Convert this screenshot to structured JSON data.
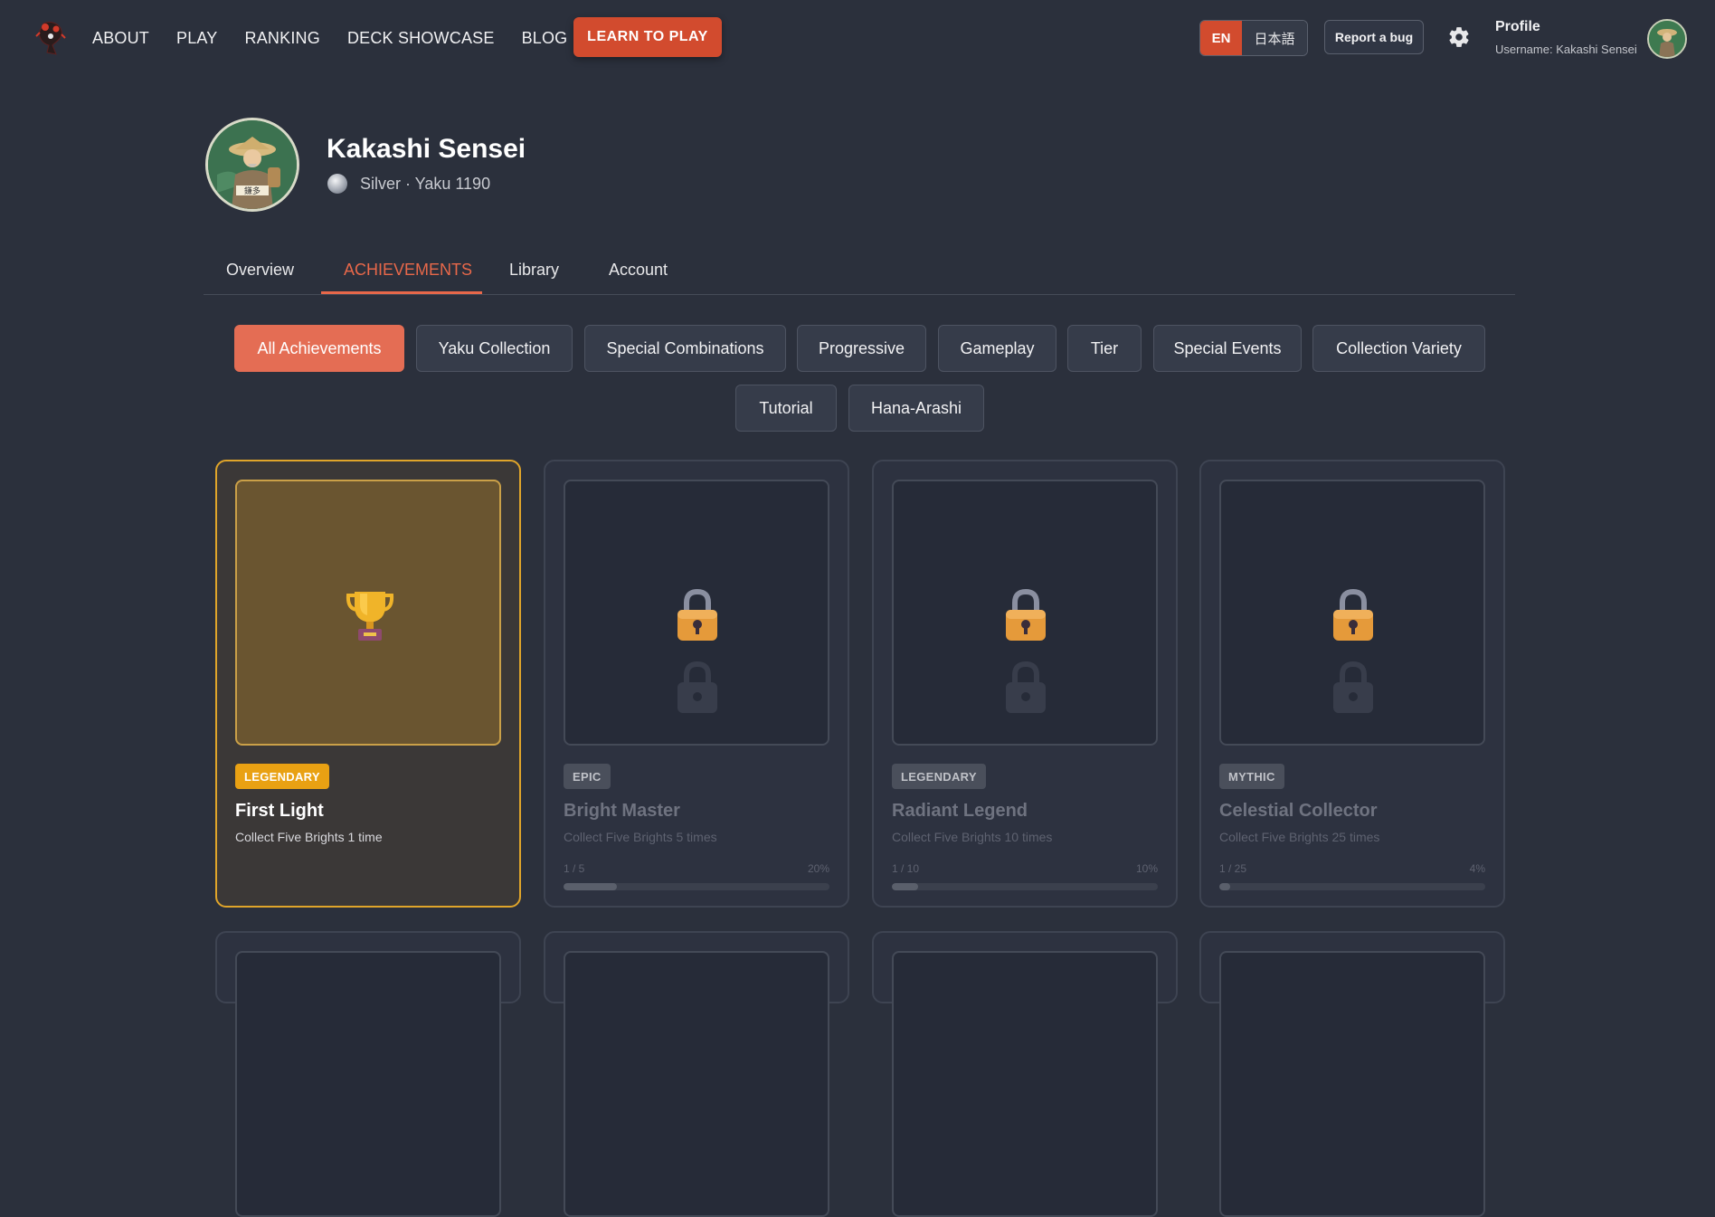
{
  "nav": {
    "items": [
      "ABOUT",
      "PLAY",
      "RANKING",
      "DECK SHOWCASE",
      "BLOG"
    ],
    "learn_label": "LEARN TO PLAY",
    "lang_en": "EN",
    "lang_ja": "日本語",
    "bug_label": "Report a bug",
    "profile_label": "Profile",
    "username_line": "Username: Kakashi Sensei"
  },
  "profile": {
    "name": "Kakashi Sensei",
    "rank_line": "Silver · Yaku 1190",
    "avatar_caption": "鎌多"
  },
  "tabs": [
    "Overview",
    "ACHIEVEMENTS",
    "Library",
    "Account"
  ],
  "filters": [
    "All Achievements",
    "Yaku Collection",
    "Special Combinations",
    "Progressive",
    "Gameplay",
    "Tier",
    "Special Events",
    "Collection Variety",
    "Tutorial",
    "Hana-Arashi"
  ],
  "cards": [
    {
      "rarity": "LEGENDARY",
      "title": "First Light",
      "desc": "Collect Five Brights 1 time",
      "unlocked": true
    },
    {
      "rarity": "EPIC",
      "title": "Bright Master",
      "desc": "Collect Five Brights 5 times",
      "progress": "1 / 5",
      "percent": "20%",
      "fraction": 0.2
    },
    {
      "rarity": "LEGENDARY",
      "title": "Radiant Legend",
      "desc": "Collect Five Brights 10 times",
      "progress": "1 / 10",
      "percent": "10%",
      "fraction": 0.1
    },
    {
      "rarity": "MYTHIC",
      "title": "Celestial Collector",
      "desc": "Collect Five Brights 25 times",
      "progress": "1 / 25",
      "percent": "4%",
      "fraction": 0.04
    }
  ],
  "colors": {
    "accent": "#e46d54",
    "legendary": "#e9a113",
    "background": "#2b303c"
  }
}
